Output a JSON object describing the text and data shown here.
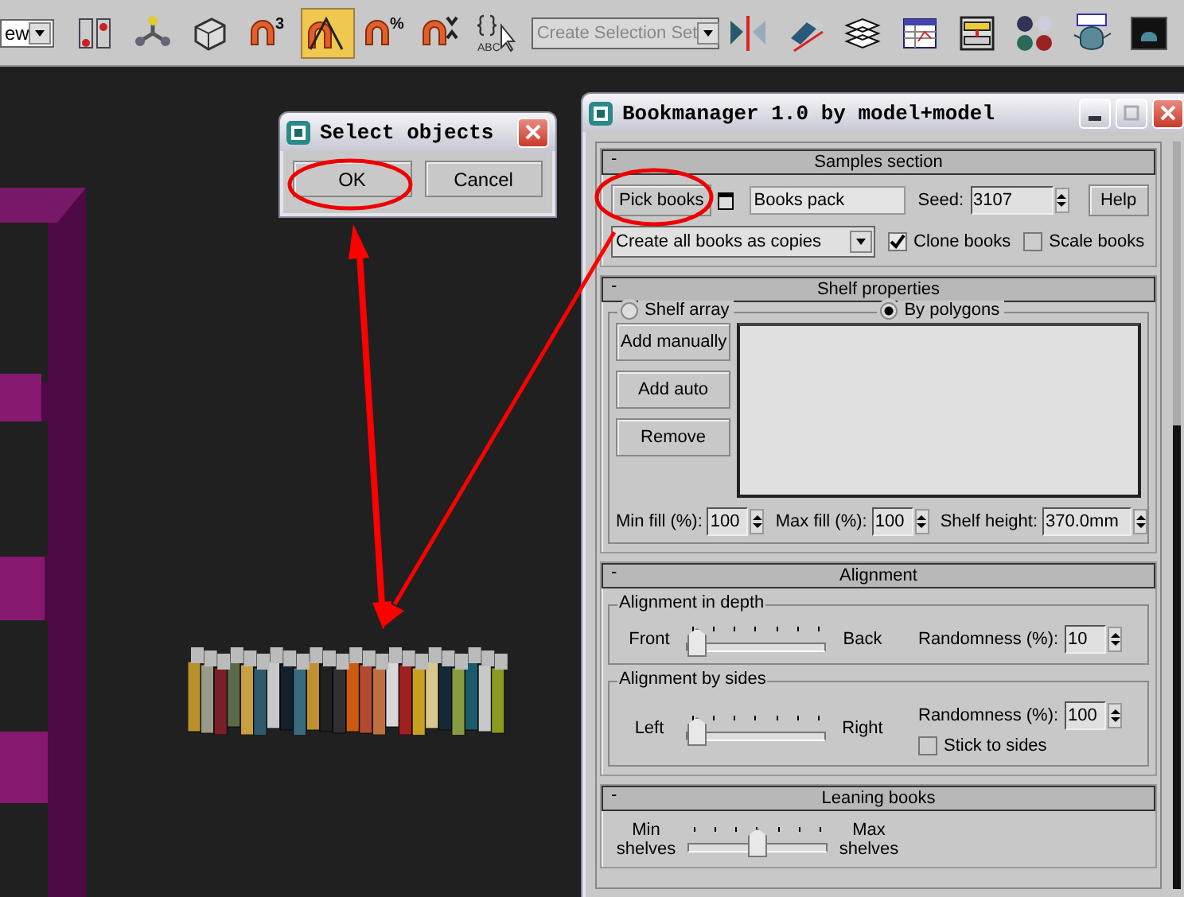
{
  "toolbar": {
    "view_dropdown": "ew",
    "selection_set": {
      "placeholder": "Create Selection Set"
    },
    "tools": [
      {
        "kind": "filter",
        "selected": false
      },
      {
        "kind": "axis",
        "selected": false
      },
      {
        "kind": "box",
        "selected": false
      },
      {
        "kind": "magnet",
        "selected": false,
        "badge": "3"
      },
      {
        "kind": "angle",
        "selected": true
      },
      {
        "kind": "magnet",
        "selected": false,
        "badge": "%"
      },
      {
        "kind": "spinner",
        "selected": false
      },
      {
        "kind": "named",
        "selected": false,
        "badge": "ABC"
      }
    ],
    "tools_right": [
      {
        "kind": "mirror",
        "selected": false
      },
      {
        "kind": "align",
        "selected": false
      },
      {
        "kind": "layers",
        "selected": false
      },
      {
        "kind": "table",
        "selected": false
      },
      {
        "kind": "schematic",
        "selected": false
      },
      {
        "kind": "spheres",
        "selected": false
      },
      {
        "kind": "teapot",
        "selected": false
      },
      {
        "kind": "frame",
        "selected": false
      }
    ]
  },
  "select_dialog": {
    "title": "Select objects",
    "buttons": [
      "OK",
      "Cancel"
    ]
  },
  "bookmanager": {
    "title": "Bookmanager 1.0 by model+model",
    "samples": {
      "toggle": "-",
      "title": "Samples section",
      "pick_button": "Pick books",
      "name_field": "Books pack",
      "seed_label": "Seed:",
      "seed": "3107",
      "help_button": "Help",
      "mode_dropdown": "Create all books as copies",
      "checkboxes": [
        {
          "label": "Clone books",
          "checked": true
        },
        {
          "label": "Scale books",
          "checked": false
        }
      ]
    },
    "shelf": {
      "toggle": "-",
      "title": "Shelf properties",
      "radios": [
        {
          "label": "Shelf array",
          "selected": false
        },
        {
          "label": "By polygons",
          "selected": true
        }
      ],
      "buttons": [
        "Add manually",
        "Add auto",
        "Remove"
      ],
      "spinners": [
        {
          "label": "Min fill (%):",
          "value": "100"
        },
        {
          "label": "Max fill (%):",
          "value": "100"
        },
        {
          "label": "Shelf height:",
          "value": "370.0mm"
        }
      ]
    },
    "alignment": {
      "toggle": "-",
      "title": "Alignment",
      "groups": [
        {
          "title": "Alignment in depth",
          "left": "Front",
          "right": "Back",
          "level": 0,
          "randomness_label": "Randomness (%):",
          "randomness": "10"
        },
        {
          "title": "Alignment by sides",
          "left": "Left",
          "right": "Right",
          "level": 0,
          "randomness_label": "Randomness (%):",
          "randomness": "100",
          "checkbox": {
            "label": "Stick to sides",
            "checked": false
          }
        }
      ]
    },
    "leaning": {
      "toggle": "-",
      "title": "Leaning books",
      "left": "Min shelves",
      "right": "Max shelves",
      "level": 0.5
    }
  }
}
